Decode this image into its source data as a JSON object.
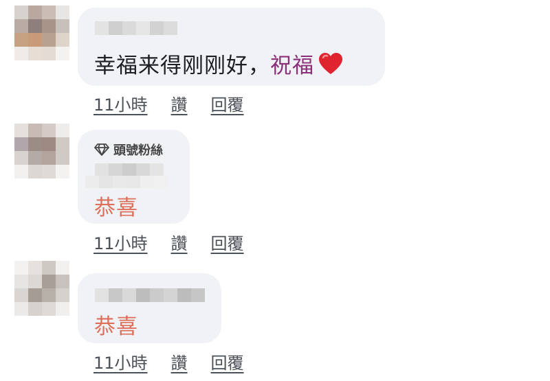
{
  "comments": [
    {
      "text_plain": "幸福来得刚刚好，",
      "text_highlight": "祝福",
      "emoji": "heart",
      "time": "11小時",
      "like_label": "讚",
      "reply_label": "回覆"
    },
    {
      "badge": "頭號粉絲",
      "badge_icon": "diamond-icon",
      "text_highlight": "恭喜",
      "time": "11小時",
      "like_label": "讚",
      "reply_label": "回覆"
    },
    {
      "text_highlight": "恭喜",
      "time": "11小時",
      "like_label": "讚",
      "reply_label": "回覆"
    }
  ],
  "colors": {
    "bubble": "#f0f2f5",
    "highlight_purple": "#8b2f7a",
    "highlight_orange": "#dd6f5b",
    "action_text": "#4b4f56"
  }
}
